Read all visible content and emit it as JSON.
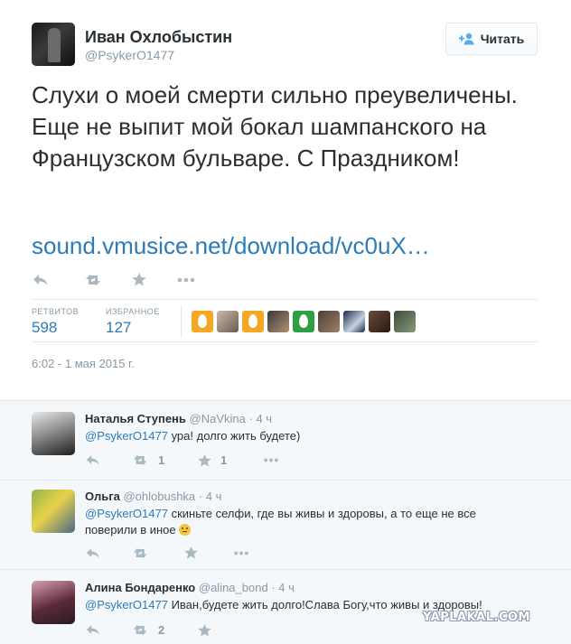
{
  "tweet": {
    "author_name": "Иван Охлобыстин",
    "author_handle": "@PsykerO1477",
    "follow_label": "Читать",
    "text": "Слухи о моей смерти сильно преувеличены. Еще не выпит мой бокал шампанского на Французском бульваре. С Праздником!",
    "link": "sound.vmusice.net/download/vc0uX…",
    "actions": [
      "reply-icon",
      "retweet-icon",
      "favorite-icon",
      "more-icon"
    ],
    "stats": {
      "retweets_label": "РЕТВИТОВ",
      "retweets_value": "598",
      "favorites_label": "ИЗБРАННОЕ",
      "favorites_value": "127"
    },
    "timestamp": "6:02 - 1 мая 2015 г."
  },
  "replies": [
    {
      "name": "Наталья Ступень",
      "handle": "@NaVkina",
      "time": "· 4 ч",
      "mention": "@PsykerO1477",
      "text": " ура! долго жить будете)",
      "retweet_count": "1",
      "favorite_count": "1"
    },
    {
      "name": "Ольга",
      "handle": "@ohlobushka",
      "time": "· 4 ч",
      "mention": "@PsykerO1477",
      "text": " скиньте селфи, где вы живы и здоровы, а то еще не все поверили в иное",
      "retweet_count": "",
      "favorite_count": ""
    },
    {
      "name": "Алина Бондаренко",
      "handle": "@alina_bond",
      "time": "· 4 ч",
      "mention": "@PsykerO1477",
      "text": " Иван,будете жить долго!Слава Богу,что живы и здоровы!",
      "retweet_count": "2",
      "favorite_count": ""
    }
  ],
  "watermark": "YAPLAKAL.COM",
  "colors": {
    "link": "#2b7bb9",
    "muted": "#8899a6",
    "icon": "#aab8c2",
    "egg_orange": "#f5a623",
    "egg_green": "#2ea043"
  }
}
